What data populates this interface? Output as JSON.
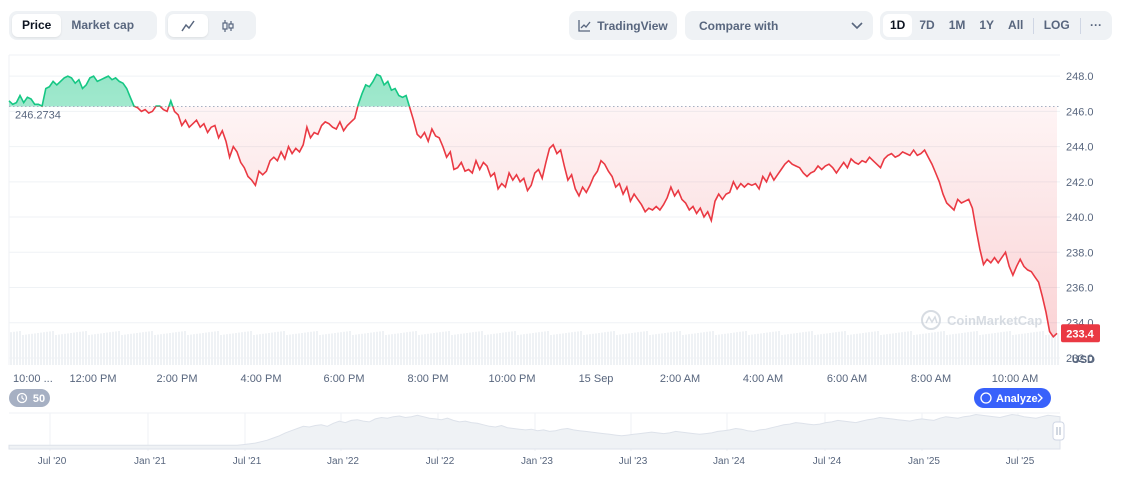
{
  "toolbar": {
    "price_label": "Price",
    "marketcap_label": "Market cap",
    "line_icon": "line-chart-icon",
    "candle_icon": "candlestick-icon",
    "tradingview_label": "TradingView",
    "tradingview_icon": "tradingview-chart-icon",
    "compare_label": "Compare with",
    "compare_icon": "chevron-down-icon",
    "ranges": [
      "1D",
      "7D",
      "1M",
      "1Y",
      "All"
    ],
    "active_range": "1D",
    "log_label": "LOG",
    "more_label": "···"
  },
  "chart_meta": {
    "currency_label": "USD",
    "current_price_label": "233.4",
    "baseline_label": "246.2734",
    "watermark": "CoinMarketCap",
    "history_badge_label": "50",
    "history_icon": "history-clock-icon",
    "analyze_label": "Analyze",
    "colors": {
      "up": "#16c784",
      "down": "#ea3943",
      "grid": "#eff2f5",
      "axis_text": "#58667e",
      "badge_bg": "#3861fb"
    }
  },
  "chart_data": [
    {
      "type": "area",
      "title": "",
      "xlabel": "",
      "ylabel": "",
      "x_tick_labels": [
        "10:00 ...",
        "12:00 PM",
        "2:00 PM",
        "4:00 PM",
        "6:00 PM",
        "8:00 PM",
        "10:00 PM",
        "15 Sep",
        "2:00 AM",
        "4:00 AM",
        "6:00 AM",
        "8:00 AM",
        "10:00 AM"
      ],
      "y_ticks": [
        232.0,
        234.0,
        236.0,
        238.0,
        240.0,
        242.0,
        244.0,
        246.0,
        248.0
      ],
      "ylim": [
        231.6,
        249.2
      ],
      "baseline": 246.2734,
      "current": 233.4,
      "grid": true,
      "series": [
        {
          "values": [
            246.6,
            246.4,
            246.5,
            246.9,
            246.5,
            246.8,
            246.7,
            246.4,
            246.4,
            246.3,
            247.3,
            247.4,
            247.7,
            247.5,
            247.7,
            247.9,
            248.0,
            247.9,
            247.6,
            247.8,
            247.3,
            247.5,
            247.9,
            248.0,
            247.7,
            247.8,
            247.9,
            248.0,
            247.8,
            247.9,
            247.7,
            247.6,
            247.3,
            246.8,
            246.3,
            246.2,
            246.0,
            246.1,
            245.9,
            246.0,
            246.3,
            246.3,
            246.1,
            246.0,
            246.6,
            246.0,
            245.8,
            245.2,
            245.5,
            245.1,
            245.3,
            245.5,
            245.1,
            245.3,
            244.8,
            245.1,
            245.2,
            244.5,
            244.9,
            244.3,
            243.4,
            244.0,
            243.7,
            243.1,
            242.8,
            242.3,
            242.1,
            241.8,
            242.6,
            242.4,
            242.6,
            243.2,
            243.4,
            243.2,
            243.7,
            243.3,
            244.0,
            243.6,
            243.9,
            243.7,
            244.1,
            245.1,
            244.5,
            244.8,
            244.7,
            245.2,
            245.4,
            245.3,
            245.1,
            245.0,
            245.4,
            244.9,
            245.2,
            245.4,
            245.6,
            246.4,
            247.0,
            247.5,
            247.4,
            247.7,
            248.1,
            248.0,
            247.5,
            247.7,
            247.2,
            247.3,
            246.9,
            246.8,
            246.9,
            246.2,
            245.5,
            244.7,
            244.5,
            244.8,
            244.3,
            245.0,
            244.6,
            244.5,
            244.0,
            243.4,
            243.7,
            242.7,
            242.8,
            243.1,
            242.6,
            242.7,
            242.5,
            243.2,
            242.7,
            243.1,
            242.9,
            242.3,
            242.5,
            241.6,
            241.9,
            241.7,
            242.5,
            242.1,
            242.4,
            242.0,
            242.2,
            241.5,
            241.8,
            242.5,
            242.7,
            242.2,
            243.1,
            243.9,
            244.1,
            243.6,
            243.8,
            242.9,
            242.1,
            242.4,
            241.6,
            241.2,
            241.7,
            241.4,
            241.8,
            242.3,
            242.6,
            243.2,
            243.0,
            242.6,
            242.3,
            241.7,
            241.9,
            241.3,
            241.7,
            240.9,
            241.3,
            241.0,
            240.7,
            240.3,
            240.5,
            240.4,
            240.6,
            240.4,
            240.7,
            241.1,
            241.7,
            241.2,
            241.5,
            241.0,
            240.8,
            240.4,
            240.6,
            240.2,
            240.5,
            240.0,
            240.3,
            239.8,
            240.9,
            241.3,
            241.0,
            241.3,
            241.4,
            242.0,
            241.6,
            241.9,
            241.7,
            241.9,
            241.8,
            241.9,
            241.6,
            242.3,
            242.0,
            242.5,
            242.1,
            242.4,
            242.7,
            243.0,
            243.2,
            243.0,
            242.9,
            242.8,
            242.5,
            242.3,
            242.5,
            242.6,
            242.9,
            242.7,
            242.9,
            243.0,
            242.8,
            242.5,
            242.8,
            243.1,
            242.8,
            243.3,
            243.1,
            243.0,
            243.2,
            243.1,
            243.4,
            243.2,
            243.0,
            242.8,
            243.3,
            243.5,
            243.6,
            243.4,
            243.5,
            243.7,
            243.6,
            243.5,
            243.8,
            243.5,
            243.6,
            243.8,
            243.4,
            243.0,
            242.5,
            242.0,
            241.3,
            240.8,
            240.6,
            240.4,
            241.0,
            240.8,
            240.9,
            241.0,
            240.5,
            239.3,
            238.2,
            237.3,
            237.6,
            237.4,
            237.7,
            237.4,
            237.7,
            238.0,
            237.2,
            236.7,
            237.2,
            237.6,
            237.2,
            237.0,
            236.9,
            236.6,
            236.3,
            235.5,
            234.6,
            233.5,
            233.2,
            233.4
          ]
        }
      ]
    },
    {
      "type": "area",
      "title": "",
      "x_tick_labels": [
        "Jul '20",
        "Jan '21",
        "Jul '21",
        "Jan '22",
        "Jul '22",
        "Jan '23",
        "Jul '23",
        "Jan '24",
        "Jul '24",
        "Jan '25",
        "Jul '25"
      ],
      "series": [
        {
          "values": [
            5,
            5,
            5,
            5,
            5,
            5,
            5,
            5,
            5,
            5,
            5,
            5,
            5,
            5,
            5,
            5,
            5,
            5,
            5,
            5,
            5,
            5,
            5,
            5,
            5,
            5,
            5,
            5,
            5,
            5,
            5,
            5,
            5,
            5,
            5,
            5,
            5,
            5,
            5,
            6,
            7,
            8,
            10,
            12,
            15,
            18,
            22,
            25,
            28,
            31,
            30,
            32,
            33,
            31,
            35,
            38,
            36,
            39,
            40,
            38,
            37,
            41,
            43,
            42,
            44,
            45,
            43,
            44,
            46,
            44,
            42,
            41,
            40,
            42,
            39,
            37,
            38,
            36,
            35,
            33,
            31,
            30,
            32,
            29,
            28,
            27,
            26,
            27,
            25,
            26,
            24,
            25,
            27,
            28,
            26,
            25,
            24,
            23,
            22,
            21,
            20,
            19,
            18,
            19,
            20,
            21,
            22,
            23,
            22,
            21,
            22,
            24,
            23,
            22,
            21,
            20,
            21,
            22,
            24,
            25,
            26,
            28,
            27,
            25,
            24,
            26,
            27,
            29,
            31,
            33,
            34,
            36,
            35,
            34,
            33,
            34,
            36,
            37,
            39,
            38,
            37,
            36,
            38,
            40,
            41,
            43,
            42,
            41,
            40,
            39,
            38,
            40,
            41,
            40,
            39,
            42,
            44,
            43,
            42,
            44,
            45,
            47,
            46,
            45,
            44,
            43,
            45,
            47,
            46,
            44,
            43,
            42,
            44,
            46,
            45,
            44
          ]
        }
      ]
    }
  ]
}
